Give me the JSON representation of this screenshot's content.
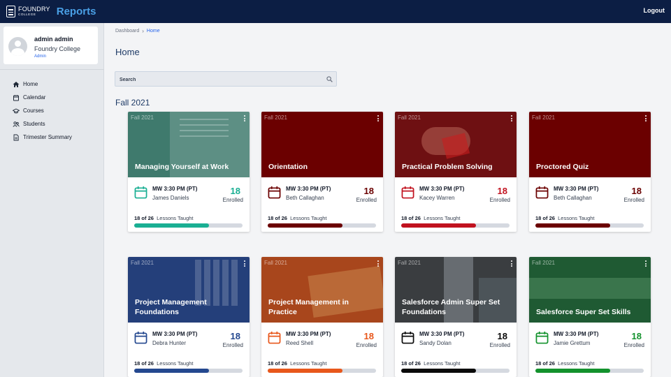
{
  "header": {
    "brand_name": "FOUNDRY",
    "brand_sub": "COLLEGE",
    "app_title": "Reports",
    "logout_label": "Logout"
  },
  "profile": {
    "name": "admin admin",
    "org": "Foundry College",
    "role": "Admin"
  },
  "sidebar": {
    "items": [
      {
        "label": "Home",
        "icon": "home-icon"
      },
      {
        "label": "Calendar",
        "icon": "calendar-icon"
      },
      {
        "label": "Courses",
        "icon": "graduation-cap-icon"
      },
      {
        "label": "Students",
        "icon": "users-icon"
      },
      {
        "label": "Trimester Summary",
        "icon": "document-icon"
      }
    ]
  },
  "breadcrumb": {
    "root": "Dashboard",
    "current": "Home"
  },
  "page_title": "Home",
  "search": {
    "placeholder": "Search"
  },
  "term_heading": "Fall 2021",
  "courses": [
    {
      "term": "Fall 2021",
      "title": "Managing Yourself at Work",
      "schedule": "MW 3:30 PM (PT)",
      "teacher": "James Daniels",
      "enrolled": "18",
      "enrolled_label": "Enrolled",
      "lessons_done": "18 of 26",
      "lessons_label": "Lessons Taught",
      "progress": 0.6923,
      "accent": "#1aaf93",
      "hero_color": "#3f7a6d"
    },
    {
      "term": "Fall 2021",
      "title": "Orientation",
      "schedule": "MW 3:30 PM (PT)",
      "teacher": "Beth Callaghan",
      "enrolled": "18",
      "enrolled_label": "Enrolled",
      "lessons_done": "18 of 26",
      "lessons_label": "Lessons Taught",
      "progress": 0.6923,
      "accent": "#6b0000",
      "hero_color": "#6b0000"
    },
    {
      "term": "Fall 2021",
      "title": "Practical Problem Solving",
      "schedule": "MW 3:30 PM (PT)",
      "teacher": "Kacey Warren",
      "enrolled": "18",
      "enrolled_label": "Enrolled",
      "lessons_done": "18 of 26",
      "lessons_label": "Lessons Taught",
      "progress": 0.6923,
      "accent": "#c1121f",
      "hero_color": "#6e1012"
    },
    {
      "term": "Fall 2021",
      "title": "Proctored Quiz",
      "schedule": "MW 3:30 PM (PT)",
      "teacher": "Beth Callaghan",
      "enrolled": "18",
      "enrolled_label": "Enrolled",
      "lessons_done": "18 of 26",
      "lessons_label": "Lessons Taught",
      "progress": 0.6923,
      "accent": "#6b0000",
      "hero_color": "#6b0000"
    },
    {
      "term": "Fall 2021",
      "title": "Project Management Foundations",
      "schedule": "MW 3:30 PM (PT)",
      "teacher": "Debra Hunter",
      "enrolled": "18",
      "enrolled_label": "Enrolled",
      "lessons_done": "18 of 26",
      "lessons_label": "Lessons Taught",
      "progress": 0.6923,
      "accent": "#24488f",
      "hero_color": "#243f7a"
    },
    {
      "term": "Fall 2021",
      "title": "Project Management in Practice",
      "schedule": "MW 3:30 PM (PT)",
      "teacher": "Reed Shell",
      "enrolled": "18",
      "enrolled_label": "Enrolled",
      "lessons_done": "18 of 26",
      "lessons_label": "Lessons Taught",
      "progress": 0.6923,
      "accent": "#e8571b",
      "hero_color": "#a8461c"
    },
    {
      "term": "Fall 2021",
      "title": "Salesforce Admin Super Set Foundations",
      "schedule": "MW 3:30 PM (PT)",
      "teacher": "Sandy Dolan",
      "enrolled": "18",
      "enrolled_label": "Enrolled",
      "lessons_done": "18 of 26",
      "lessons_label": "Lessons Taught",
      "progress": 0.6923,
      "accent": "#0a0a0a",
      "hero_color": "#3a3d40"
    },
    {
      "term": "Fall 2021",
      "title": "Salesforce Super Set Skills",
      "schedule": "MW 3:30 PM (PT)",
      "teacher": "Jamie Grettum",
      "enrolled": "18",
      "enrolled_label": "Enrolled",
      "lessons_done": "18 of 26",
      "lessons_label": "Lessons Taught",
      "progress": 0.6923,
      "accent": "#13922d",
      "hero_color": "#1f5a33"
    }
  ]
}
